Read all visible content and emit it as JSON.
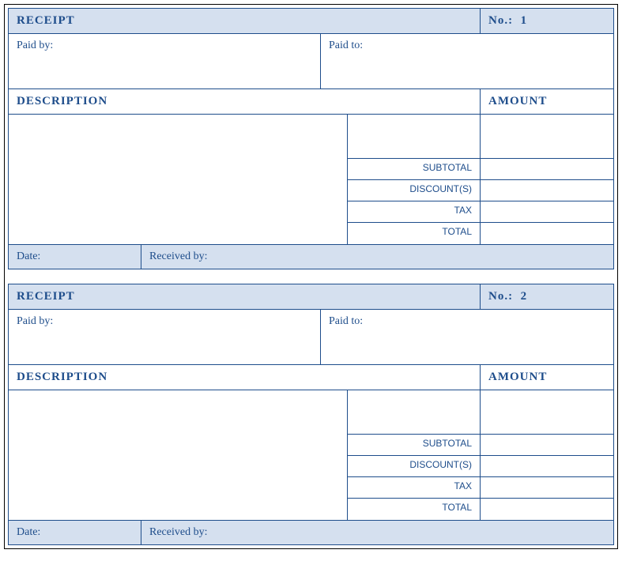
{
  "receipts": [
    {
      "title": "RECEIPT",
      "no_label": "No.:",
      "no_value": "1",
      "paid_by_label": "Paid by:",
      "paid_to_label": "Paid to:",
      "description_header": "DESCRIPTION",
      "amount_header": "AMOUNT",
      "subtotal_label": "SUBTOTAL",
      "discount_label": "DISCOUNT(S)",
      "tax_label": "TAX",
      "total_label": "TOTAL",
      "date_label": "Date:",
      "received_by_label": "Received by:"
    },
    {
      "title": "RECEIPT",
      "no_label": "No.:",
      "no_value": "2",
      "paid_by_label": "Paid by:",
      "paid_to_label": "Paid to:",
      "description_header": "DESCRIPTION",
      "amount_header": "AMOUNT",
      "subtotal_label": "SUBTOTAL",
      "discount_label": "DISCOUNT(S)",
      "tax_label": "TAX",
      "total_label": "TOTAL",
      "date_label": "Date:",
      "received_by_label": "Received by:"
    }
  ]
}
